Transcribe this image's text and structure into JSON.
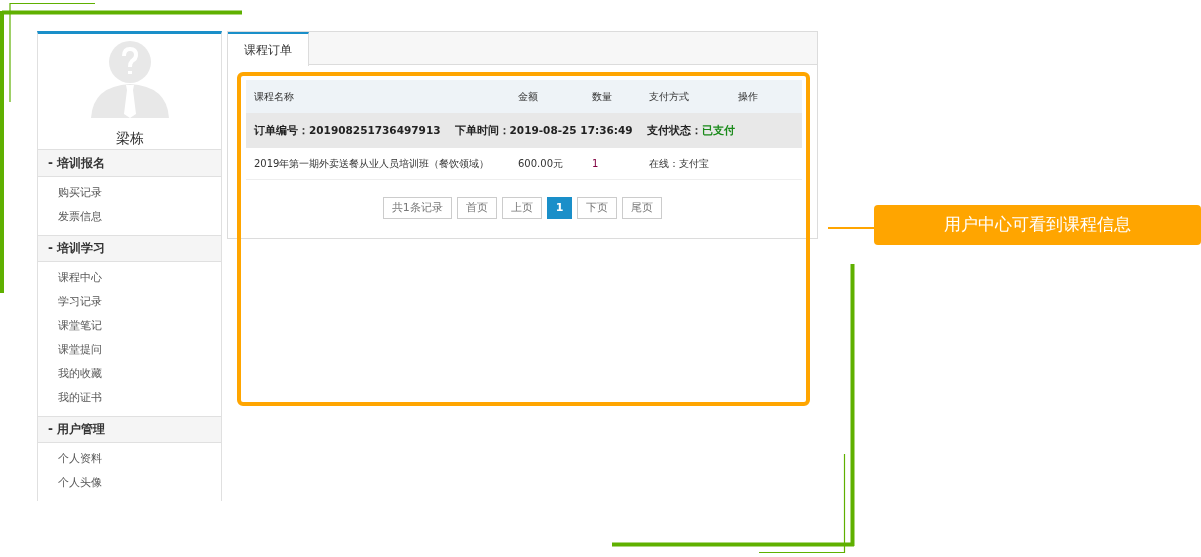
{
  "sidebar": {
    "user_name": "梁栋",
    "sections": [
      {
        "title": "- 培训报名",
        "items": [
          "购买记录",
          "发票信息"
        ]
      },
      {
        "title": "- 培训学习",
        "items": [
          "课程中心",
          "学习记录",
          "课堂笔记",
          "课堂提问",
          "我的收藏",
          "我的证书"
        ]
      },
      {
        "title": "- 用户管理",
        "items": [
          "个人资料",
          "个人头像"
        ]
      }
    ]
  },
  "tabs": [
    {
      "label": "课程订单",
      "selected": true
    }
  ],
  "table": {
    "columns": [
      "课程名称",
      "金额",
      "数量",
      "支付方式",
      "操作"
    ],
    "orders": [
      {
        "order_label": "订单编号：",
        "order_no": "201908251736497913",
        "time_label": "下单时间：",
        "time": "2019-08-25 17:36:49",
        "status_label": "支付状态：",
        "status": "已支付",
        "rows": [
          [
            "2019年第一期外卖送餐从业人员培训班（餐饮领域）",
            "600.00元",
            "1",
            "在线：支付宝"
          ]
        ]
      }
    ]
  },
  "pagination": {
    "summary": "共1条记录",
    "buttons": [
      {
        "label": "首页",
        "selected": false
      },
      {
        "label": "上页",
        "selected": false
      },
      {
        "label": "1",
        "selected": true
      },
      {
        "label": "下页",
        "selected": false
      },
      {
        "label": "尾页",
        "selected": false
      }
    ]
  },
  "callout": {
    "text": "用户中心可看到课程信息"
  }
}
